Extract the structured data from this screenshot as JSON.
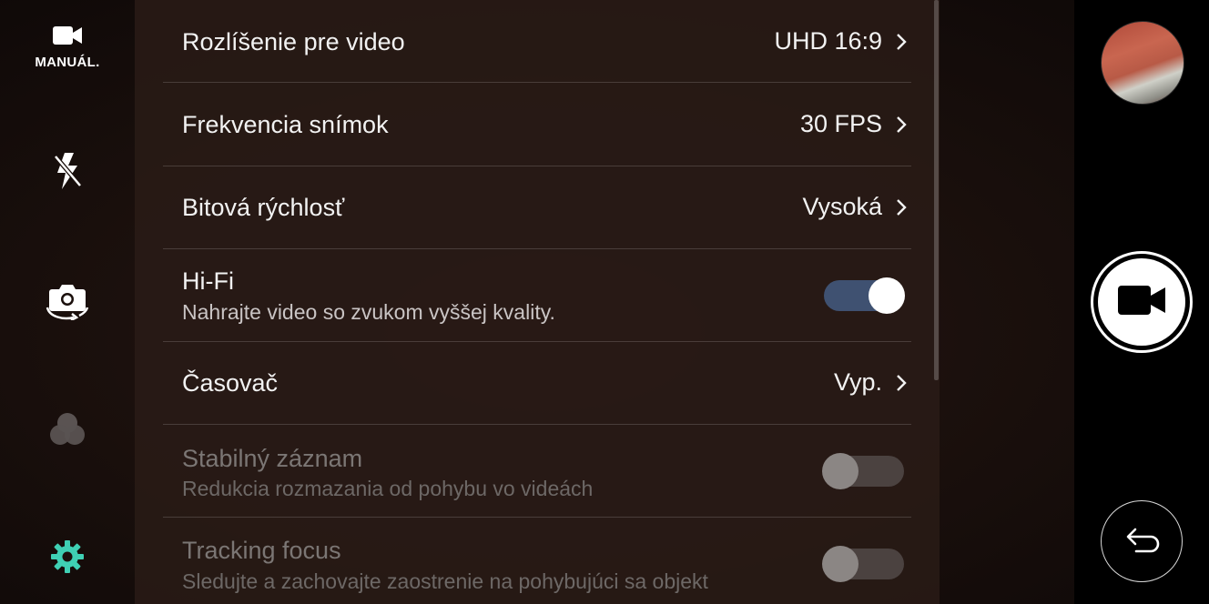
{
  "left_rail": {
    "mode_icon": "video-camera-icon",
    "mode_label": "MANUÁL.",
    "flash_icon": "flash-off-icon",
    "switch_camera_icon": "switch-camera-icon",
    "filter_icon": "filter-circles-icon",
    "settings_icon": "gear-icon",
    "settings_color": "#3fd0b4"
  },
  "settings": {
    "rows": [
      {
        "title": "Rozlíšenie pre video",
        "value": "UHD 16:9"
      },
      {
        "title": "Frekvencia snímok",
        "value": "30 FPS"
      },
      {
        "title": "Bitová rýchlosť",
        "value": "Vysoká"
      },
      {
        "title": "Hi-Fi",
        "subtitle": "Nahrajte video so zvukom vyššej kvality.",
        "toggle": "on"
      },
      {
        "title": "Časovač",
        "value": "Vyp."
      },
      {
        "title": "Stabilný záznam",
        "subtitle": "Redukcia rozmazania od pohybu vo videách",
        "toggle": "off",
        "disabled": true
      },
      {
        "title": "Tracking focus",
        "subtitle": "Sledujte a zachovajte zaostrenie na pohybujúci sa objekt",
        "toggle": "off",
        "disabled": true
      }
    ]
  },
  "right_rail": {
    "gallery_thumbnail": "gallery-thumbnail",
    "record_icon": "video-camera-icon",
    "back_icon": "back-arrow-icon"
  },
  "colors": {
    "toggle_on_track": "#3f5171",
    "accent": "#3fd0b4"
  }
}
